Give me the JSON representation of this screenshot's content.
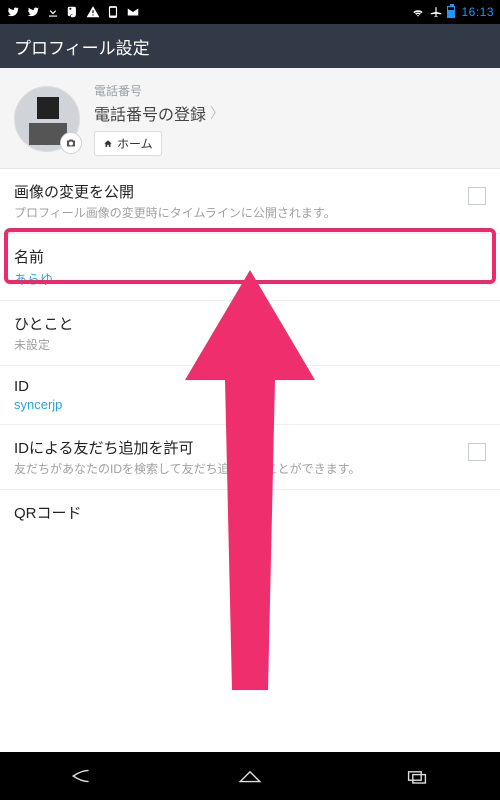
{
  "statusbar": {
    "time": "16:13"
  },
  "header": {
    "title": "プロフィール設定"
  },
  "profile": {
    "phone_label": "電話番号",
    "phone_register": "電話番号の登録",
    "home_button": "ホーム"
  },
  "rows": {
    "publish_image": {
      "title": "画像の変更を公開",
      "sub": "プロフィール画像の変更時にタイムラインに公開されます。"
    },
    "name": {
      "title": "名前",
      "value": "あらゆ"
    },
    "status_msg": {
      "title": "ひとこと",
      "value": "未設定"
    },
    "id": {
      "title": "ID",
      "value": "syncerjp"
    },
    "allow_add": {
      "title": "IDによる友だち追加を許可",
      "sub": "友だちがあなたのIDを検索して友だち追加することができます。"
    },
    "qr": {
      "title": "QRコード"
    }
  },
  "colors": {
    "highlight": "#ec2a6a",
    "link": "#2aa3d8"
  }
}
